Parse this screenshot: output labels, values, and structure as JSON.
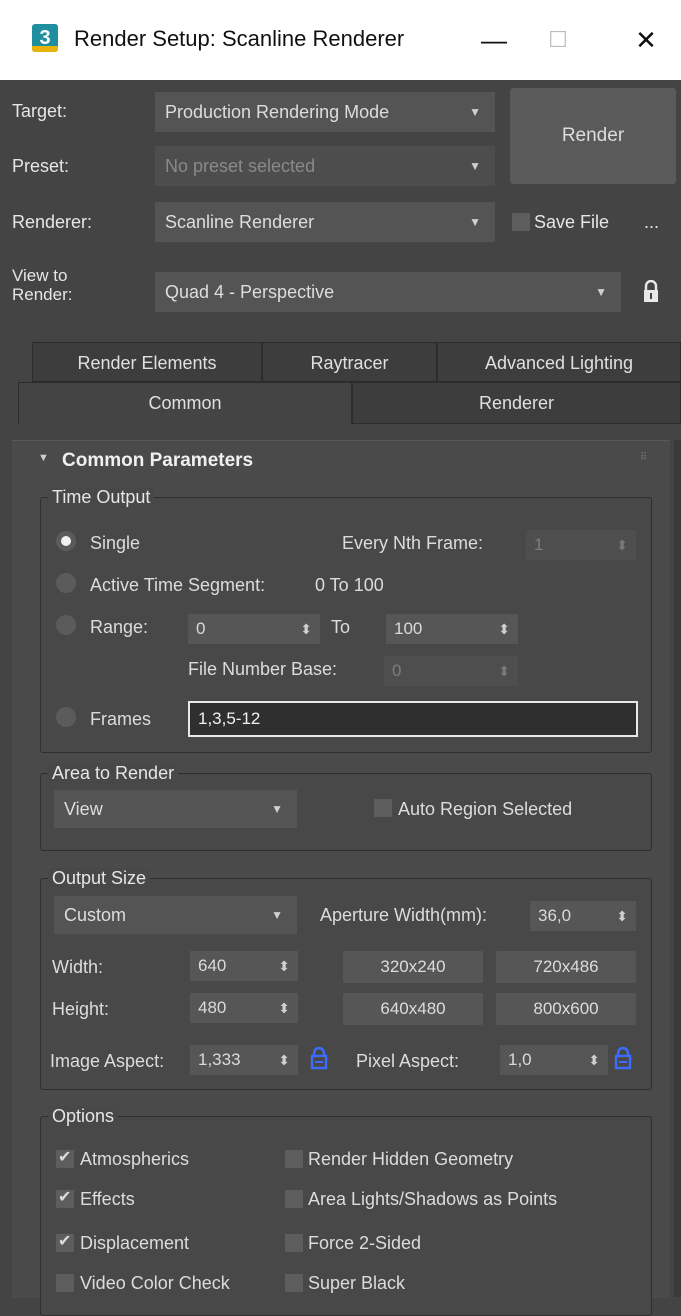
{
  "window": {
    "title": "Render Setup: Scanline Renderer",
    "app_icon_text": "3",
    "minimize": "—",
    "maximize": "☐",
    "close": "✕"
  },
  "controls": {
    "target_label": "Target:",
    "target_value": "Production Rendering Mode",
    "preset_label": "Preset:",
    "preset_value": "No preset selected",
    "renderer_label": "Renderer:",
    "renderer_value": "Scanline Renderer",
    "save_file_label": "Save File",
    "save_file_checked": false,
    "more_label": "...",
    "view_label_line1": "View to",
    "view_label_line2": "Render:",
    "view_value": "Quad 4 - Perspective",
    "render_button": "Render"
  },
  "tabs_row1": [
    "Render Elements",
    "Raytracer",
    "Advanced Lighting"
  ],
  "tabs_row2": [
    "Common",
    "Renderer"
  ],
  "active_tab": "Common",
  "rollout": {
    "title": "Common Parameters",
    "collapse_glyph": "▼"
  },
  "time_output": {
    "title": "Time Output",
    "single": "Single",
    "every_nth_label": "Every Nth Frame:",
    "every_nth_value": "1",
    "active_segment": "Active Time Segment:",
    "active_segment_value": "0 To 100",
    "range": "Range:",
    "range_from": "0",
    "range_to_label": "To",
    "range_to": "100",
    "file_number_base_label": "File Number Base:",
    "file_number_base_value": "0",
    "frames": "Frames",
    "frames_value": "1,3,5-12",
    "selected": "Single"
  },
  "area_to_render": {
    "title": "Area to Render",
    "value": "View",
    "auto_region_label": "Auto Region Selected",
    "auto_region_checked": false
  },
  "output_size": {
    "title": "Output Size",
    "preset": "Custom",
    "aperture_label": "Aperture Width(mm):",
    "aperture_value": "36,0",
    "width_label": "Width:",
    "width_value": "640",
    "height_label": "Height:",
    "height_value": "480",
    "presets": [
      "320x240",
      "720x486",
      "640x480",
      "800x600"
    ],
    "image_aspect_label": "Image Aspect:",
    "image_aspect_value": "1,333",
    "pixel_aspect_label": "Pixel Aspect:",
    "pixel_aspect_value": "1,0"
  },
  "options": {
    "title": "Options",
    "items": [
      {
        "label": "Atmospherics",
        "checked": true
      },
      {
        "label": "Render Hidden Geometry",
        "checked": false
      },
      {
        "label": "Effects",
        "checked": true
      },
      {
        "label": "Area Lights/Shadows as Points",
        "checked": false
      },
      {
        "label": "Displacement",
        "checked": true
      },
      {
        "label": "Force 2-Sided",
        "checked": false
      },
      {
        "label": "Video Color Check",
        "checked": false
      },
      {
        "label": "Super Black",
        "checked": false
      }
    ]
  },
  "colors": {
    "background": "#444444",
    "panel": "#4a4a4a",
    "titlebar": "#ffffff",
    "accent_lock": "#3c6cff",
    "text": "#dcdcdc"
  }
}
